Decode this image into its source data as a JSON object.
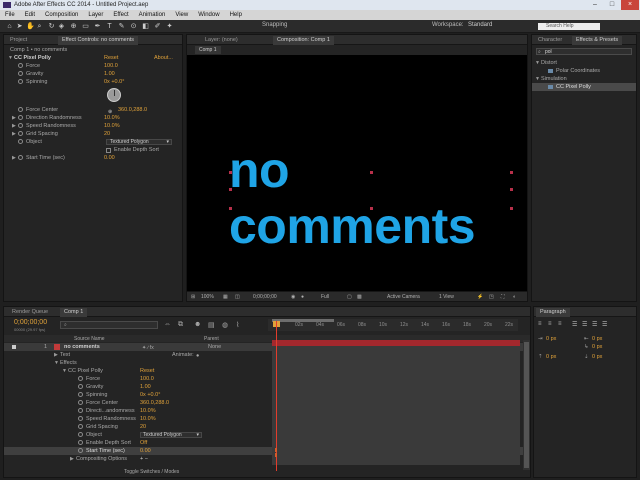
{
  "window": {
    "title": "Adobe After Effects CC 2014 - Untitled Project.aep"
  },
  "menu": [
    "File",
    "Edit",
    "Composition",
    "Layer",
    "Effect",
    "Animation",
    "View",
    "Window",
    "Help"
  ],
  "toolbar": {
    "snapping": "Snapping",
    "workspace_label": "Workspace:",
    "workspace_value": "Standard",
    "search_placeholder": "Search Help"
  },
  "project_tabs": {
    "project": "Project",
    "effect_controls": "Effect Controls: no comments"
  },
  "effect_controls": {
    "breadcrumb": "Comp 1 • no comments",
    "effect_name": "CC Pixel Polly",
    "reset": "Reset",
    "about": "About...",
    "params": [
      {
        "name": "Force",
        "value": "100.0"
      },
      {
        "name": "Gravity",
        "value": "1.00"
      },
      {
        "name": "Spinning",
        "value": "0x +0.0°"
      },
      {
        "name": "Force Center",
        "value": "360.0,288.0"
      },
      {
        "name": "Direction Randomness",
        "value": "10.0%"
      },
      {
        "name": "Speed Randomness",
        "value": "10.0%"
      },
      {
        "name": "Grid Spacing",
        "value": "20"
      },
      {
        "name": "Object",
        "value": "Textured Polygon"
      },
      {
        "name": "",
        "value": "Enable Depth Sort"
      },
      {
        "name": "Start Time (sec)",
        "value": "0.00"
      }
    ]
  },
  "viewer": {
    "layer_tab": "Layer: (none)",
    "comp_tab": "Composition: Comp 1",
    "comp_subtab": "Comp 1",
    "text": "no comments",
    "zoom": "100%",
    "timecode": "0;00;00;00",
    "resolution": "Full",
    "camera": "Active Camera",
    "views": "1 View"
  },
  "right_panel": {
    "tab_character": "Character",
    "tab_effects": "Effects & Presets",
    "search_value": "pol",
    "categories": [
      {
        "name": "Distort",
        "items": [
          "Polar Coordinates"
        ]
      },
      {
        "name": "Simulation",
        "items": [
          "CC Pixel Polly"
        ]
      }
    ],
    "paragraph_tab": "Paragraph",
    "paragraph_values": [
      "0 px",
      "0 px",
      "0 px",
      "0 px",
      "0 px"
    ]
  },
  "timeline": {
    "render_queue_tab": "Render Queue",
    "comp_tab": "Comp 1",
    "timecode": "0;00;00;00",
    "timecode_sub": "00000 (29.97 fps)",
    "col_source": "Source Name",
    "col_parent": "Parent",
    "layer_index": "1",
    "layer_name": "no comments",
    "parent_value": "None",
    "animate_label": "Animate:",
    "rows": [
      {
        "label": "Text",
        "value": ""
      },
      {
        "label": "Effects",
        "value": ""
      },
      {
        "label": "CC Pixel Polly",
        "value": "Reset"
      },
      {
        "label": "Force",
        "value": "100.0"
      },
      {
        "label": "Gravity",
        "value": "1.00"
      },
      {
        "label": "Spinning",
        "value": "0x +0.0°"
      },
      {
        "label": "Force Center",
        "value": "360.0,288.0"
      },
      {
        "label": "Directi...andomness",
        "value": "10.0%"
      },
      {
        "label": "Speed Randomness",
        "value": "10.0%"
      },
      {
        "label": "Grid Spacing",
        "value": "20"
      },
      {
        "label": "Object",
        "value": "Textured Polygon"
      },
      {
        "label": "Enable Depth Sort",
        "value": "Off"
      },
      {
        "label": "Start Time (sec)",
        "value": "0.00"
      },
      {
        "label": "Compositing Options",
        "value": "+ −"
      }
    ],
    "ruler_ticks": [
      "0s",
      "02s",
      "04s",
      "06s",
      "08s",
      "10s",
      "12s",
      "14s",
      "16s",
      "18s",
      "20s",
      "22s"
    ],
    "footer": "Toggle Switches / Modes"
  }
}
